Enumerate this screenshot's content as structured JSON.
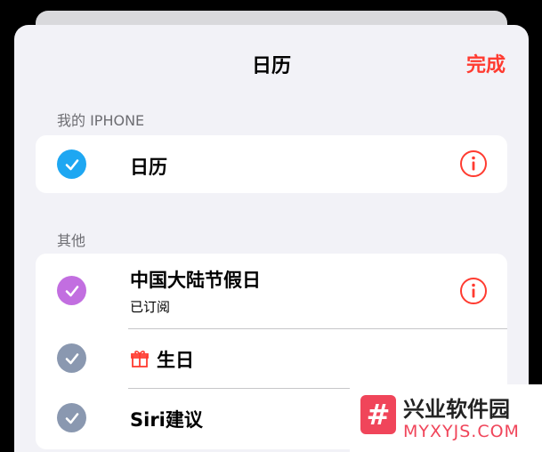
{
  "header": {
    "title": "日历",
    "done_label": "完成"
  },
  "sections": [
    {
      "header": "我的 IPHONE",
      "rows": [
        {
          "label": "日历",
          "check_color": "#1ea7f2",
          "has_info": true
        }
      ]
    },
    {
      "header": "其他",
      "rows": [
        {
          "label": "中国大陆节假日",
          "subtitle": "已订阅",
          "check_color": "#c26ee0",
          "has_info": true
        },
        {
          "label": "生日",
          "check_color": "#8a98b0",
          "icon": "gift-icon"
        },
        {
          "label": "Siri建议",
          "check_color": "#8a98b0"
        }
      ]
    }
  ],
  "colors": {
    "accent": "#ff3b30",
    "background": "#f2f2f7"
  },
  "watermark": {
    "logo_glyph": "#",
    "title": "兴业软件园",
    "url": "MYXYJS.COM"
  }
}
